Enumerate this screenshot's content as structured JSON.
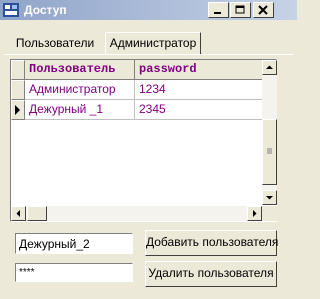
{
  "window": {
    "title": "Доступ",
    "app_icon": "app-icon",
    "controls": [
      "minimize-icon",
      "maximize-icon",
      "close-icon"
    ]
  },
  "tabs": [
    {
      "label": "Пользователи",
      "active": false
    },
    {
      "label": "Администратор",
      "active": true
    }
  ],
  "grid": {
    "columns": [
      "Пользователь",
      "password"
    ],
    "rows": [
      {
        "user": "Администратор",
        "password": "1234",
        "current": false
      },
      {
        "user": "Дежурный _1",
        "password": "2345",
        "current": true
      }
    ],
    "text_color": "#800080"
  },
  "form": {
    "username_value": "Дежурный_2",
    "password_value": "****",
    "add_button": "Добавить пользователя",
    "delete_button": "Удалить пользователя"
  }
}
